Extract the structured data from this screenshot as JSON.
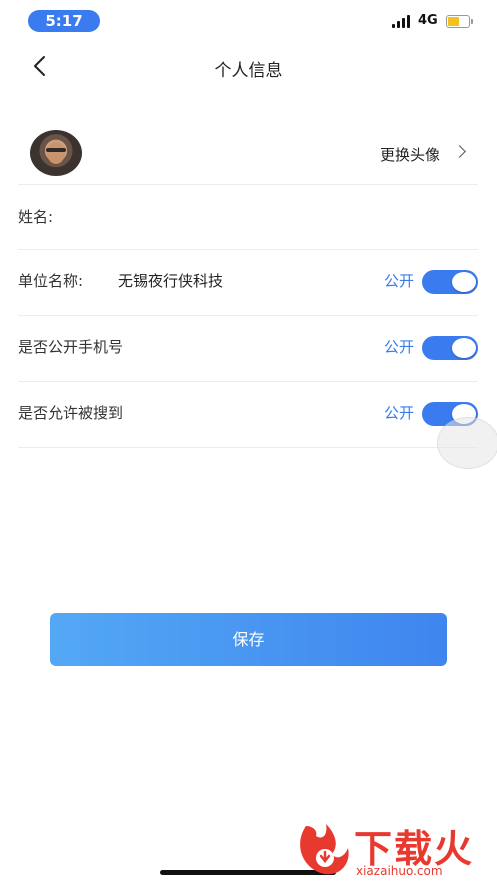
{
  "status_bar": {
    "time": "5:17",
    "network": "4G",
    "battery_color": "#f4c21f",
    "accent": "#3a7bf0"
  },
  "nav": {
    "back_icon": "chevron-left-icon",
    "title": "个人信息"
  },
  "avatar_row": {
    "action_label": "更换头像",
    "chevron_icon": "chevron-right-icon"
  },
  "name_row": {
    "label": "姓名:",
    "value": ""
  },
  "unit_row": {
    "label": "单位名称:",
    "value": "无锡夜行侠科技",
    "public_label": "公开",
    "public_on": true
  },
  "phone_row": {
    "label": "是否公开手机号",
    "public_label": "公开",
    "public_on": true
  },
  "search_row": {
    "label": "是否允许被搜到",
    "public_label": "公开",
    "public_on": true
  },
  "save_button": {
    "label": "保存",
    "gradient": [
      "#53a8f5",
      "#3f85ee"
    ]
  },
  "watermark": {
    "title": "下载火",
    "url": "xiazaihuo.com",
    "color": "#e8392f"
  }
}
